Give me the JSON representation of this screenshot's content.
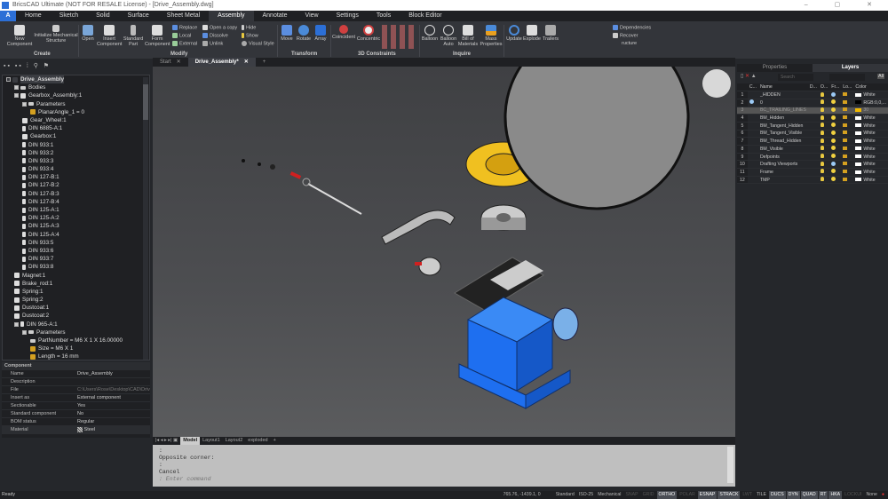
{
  "window": {
    "title": "BricsCAD Ultimate (NOT FOR RESALE License) - [Drive_Assembly.dwg]",
    "controls": "– ▢ ✕"
  },
  "menu": {
    "app_icon": "A",
    "tabs": [
      "Home",
      "Sketch",
      "Solid",
      "Surface",
      "Sheet Metal",
      "Assembly",
      "Annotate",
      "View",
      "Settings",
      "Tools",
      "Block Editor"
    ],
    "active": "Assembly"
  },
  "ribbon": {
    "create": {
      "label": "Create",
      "new_component": "New Component",
      "init_mech": "Initialize Mechanical Structure"
    },
    "modify": {
      "label": "Modify",
      "open": "Open",
      "insert": "Insert Component",
      "standard": "Standard Part",
      "form": "Form Component",
      "replace": "Replace",
      "local": "Local",
      "external": "External",
      "open_copy": "Open a copy",
      "dissolve": "Dissolve",
      "unlink": "Unlink",
      "hide": "Hide",
      "show": "Show",
      "visual_style": "Visual Style"
    },
    "transform": {
      "label": "Transform",
      "move": "Move",
      "rotate": "Rotate",
      "array": "Array"
    },
    "constraints": {
      "label": "3D Constraints",
      "coincident": "Coincident",
      "concentric": "Concentric"
    },
    "inquire": {
      "label": "Inquire",
      "balloon": "Balloon",
      "balloon_auto": "Balloon Auto",
      "bom": "Bill of Materials",
      "mass": "Mass Properties"
    },
    "more": {
      "update": "Update",
      "explode": "Explode",
      "trailers": "Trailers",
      "dependencies": "Dependencies",
      "recover": "Recover",
      "structure": "ructure"
    }
  },
  "doc_tabs": [
    "Start",
    "Drive_Assembly*"
  ],
  "tree": {
    "nodes": [
      {
        "label": "Drive_Assembly",
        "level": 0,
        "icon": "assembly",
        "root": true
      },
      {
        "label": "Bodies",
        "level": 1,
        "icon": "folder"
      },
      {
        "label": "Gearbox_Assembly:1",
        "level": 1,
        "icon": "assembly"
      },
      {
        "label": "Parameters",
        "level": 2,
        "icon": "folder"
      },
      {
        "label": "PlanarAngle_1 = 0",
        "level": 3,
        "icon": "lock"
      },
      {
        "label": "Gear_Wheel:1",
        "level": 2,
        "icon": "part"
      },
      {
        "label": "DIN 6885-A:1",
        "level": 2,
        "icon": "bolt"
      },
      {
        "label": "Gearbox:1",
        "level": 2,
        "icon": "part"
      },
      {
        "label": "DIN 933:1",
        "level": 2,
        "icon": "bolt"
      },
      {
        "label": "DIN 933:2",
        "level": 2,
        "icon": "bolt"
      },
      {
        "label": "DIN 933:3",
        "level": 2,
        "icon": "bolt"
      },
      {
        "label": "DIN 933:4",
        "level": 2,
        "icon": "bolt"
      },
      {
        "label": "DIN 127-B:1",
        "level": 2,
        "icon": "bolt"
      },
      {
        "label": "DIN 127-B:2",
        "level": 2,
        "icon": "bolt"
      },
      {
        "label": "DIN 127-B:3",
        "level": 2,
        "icon": "bolt"
      },
      {
        "label": "DIN 127-B:4",
        "level": 2,
        "icon": "bolt"
      },
      {
        "label": "DIN 125-A:1",
        "level": 2,
        "icon": "bolt"
      },
      {
        "label": "DIN 125-A:2",
        "level": 2,
        "icon": "bolt"
      },
      {
        "label": "DIN 125-A:3",
        "level": 2,
        "icon": "bolt"
      },
      {
        "label": "DIN 125-A:4",
        "level": 2,
        "icon": "bolt"
      },
      {
        "label": "DIN 933:5",
        "level": 2,
        "icon": "bolt"
      },
      {
        "label": "DIN 933:6",
        "level": 2,
        "icon": "bolt"
      },
      {
        "label": "DIN 933:7",
        "level": 2,
        "icon": "bolt"
      },
      {
        "label": "DIN 933:8",
        "level": 2,
        "icon": "bolt"
      },
      {
        "label": "Magnet:1",
        "level": 1,
        "icon": "part"
      },
      {
        "label": "Brake_rod:1",
        "level": 1,
        "icon": "part"
      },
      {
        "label": "Spring:1",
        "level": 1,
        "icon": "part"
      },
      {
        "label": "Spring:2",
        "level": 1,
        "icon": "part"
      },
      {
        "label": "Dustcoat:1",
        "level": 1,
        "icon": "part"
      },
      {
        "label": "Dustcoat:2",
        "level": 1,
        "icon": "part"
      },
      {
        "label": "DIN 965-A:1",
        "level": 1,
        "icon": "bolt"
      },
      {
        "label": "Parameters",
        "level": 2,
        "icon": "folder"
      },
      {
        "label": "PartNumber = M6 X 1 X 16.00000",
        "level": 3,
        "icon": "folder"
      },
      {
        "label": "Size = M6 X 1",
        "level": 3,
        "icon": "lock"
      },
      {
        "label": "Length = 16 mm",
        "level": 3,
        "icon": "lock"
      }
    ]
  },
  "properties": {
    "section": "Component",
    "rows": [
      {
        "k": "Name",
        "v": "Drive_Assembly"
      },
      {
        "k": "Description",
        "v": ""
      },
      {
        "k": "File",
        "v": "C:\\Users\\Rose\\Desktop\\CAD\\Drive"
      },
      {
        "k": "Insert as",
        "v": "External component"
      },
      {
        "k": "Sectionable",
        "v": "Yes"
      },
      {
        "k": "Standard component",
        "v": "No"
      },
      {
        "k": "BOM status",
        "v": "Regular"
      }
    ],
    "material_label": "Material",
    "material_value": "Steel"
  },
  "layout_tabs": [
    "Model",
    "Layout1",
    "Layout2",
    "exploded",
    "+"
  ],
  "command": {
    "lines": [
      ":",
      "Opposite corner:",
      ":",
      "Cancel"
    ],
    "placeholder": ": Enter command"
  },
  "status": {
    "ready": "Ready",
    "coords": "765.76, -1439.1, 0",
    "items": [
      {
        "t": "Standard",
        "s": "n"
      },
      {
        "t": "ISO-25",
        "s": "n"
      },
      {
        "t": "Mechanical",
        "s": "n"
      },
      {
        "t": "SNAP",
        "s": "off"
      },
      {
        "t": "GRID",
        "s": "off"
      },
      {
        "t": "ORTHO",
        "s": "on"
      },
      {
        "t": "POLAR",
        "s": "off"
      },
      {
        "t": "ESNAP",
        "s": "on"
      },
      {
        "t": "STRACK",
        "s": "on"
      },
      {
        "t": "LWT",
        "s": "off"
      },
      {
        "t": "TILE",
        "s": "n"
      },
      {
        "t": "DUCS",
        "s": "on"
      },
      {
        "t": "DYN",
        "s": "on"
      },
      {
        "t": "QUAD",
        "s": "on"
      },
      {
        "t": "RT",
        "s": "on"
      },
      {
        "t": "HKA",
        "s": "on"
      },
      {
        "t": "LOCKUI",
        "s": "off"
      },
      {
        "t": "None",
        "s": "n"
      }
    ]
  },
  "layers_panel": {
    "tabs": [
      "Properties",
      "Layers"
    ],
    "search_placeholder": "Search",
    "all": "All",
    "headers": [
      "C...",
      "Name",
      "D...",
      "O...",
      "Fr...",
      "Lo...",
      "Color"
    ],
    "rows": [
      {
        "n": "1",
        "name": "_HIDDEN",
        "cur": false,
        "frozen": true,
        "color": "White",
        "hex": "#ffffff"
      },
      {
        "n": "2",
        "name": "0",
        "cur": true,
        "frozen": false,
        "color": "RGB:0,0,...",
        "hex": "#000000"
      },
      {
        "n": "3",
        "name": "BC_TRAILING_LINES",
        "cur": false,
        "frozen": false,
        "color": "30",
        "hex": "#f0b800",
        "sel": true
      },
      {
        "n": "4",
        "name": "BM_Hidden",
        "cur": false,
        "frozen": false,
        "color": "White",
        "hex": "#ffffff"
      },
      {
        "n": "5",
        "name": "BM_Tangent_Hidden",
        "cur": false,
        "frozen": false,
        "color": "White",
        "hex": "#ffffff"
      },
      {
        "n": "6",
        "name": "BM_Tangent_Visible",
        "cur": false,
        "frozen": false,
        "color": "White",
        "hex": "#ffffff"
      },
      {
        "n": "7",
        "name": "BM_Thread_Hidden",
        "cur": false,
        "frozen": false,
        "color": "White",
        "hex": "#ffffff"
      },
      {
        "n": "8",
        "name": "BM_Visible",
        "cur": false,
        "frozen": false,
        "color": "White",
        "hex": "#ffffff"
      },
      {
        "n": "9",
        "name": "Defpoints",
        "cur": false,
        "frozen": false,
        "color": "White",
        "hex": "#ffffff"
      },
      {
        "n": "10",
        "name": "Drafting Viewports",
        "cur": false,
        "frozen": true,
        "color": "White",
        "hex": "#ffffff"
      },
      {
        "n": "11",
        "name": "Frame",
        "cur": false,
        "frozen": false,
        "color": "White",
        "hex": "#ffffff"
      },
      {
        "n": "12",
        "name": "TMP",
        "cur": false,
        "frozen": false,
        "color": "White",
        "hex": "#ffffff"
      }
    ]
  },
  "colors": {
    "accent": "#2c6fd6",
    "gearbox": "#1e6ff0",
    "gear": "#f0c020"
  }
}
